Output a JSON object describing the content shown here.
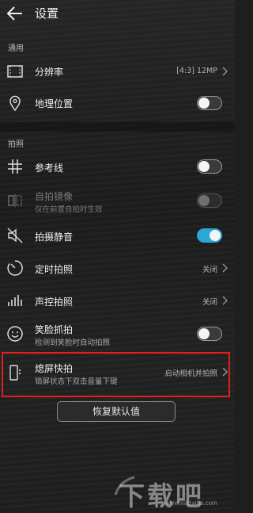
{
  "header": {
    "title": "设置"
  },
  "sections": {
    "general": "通用",
    "photo": "拍照"
  },
  "rows": {
    "resolution": {
      "label": "分辨率",
      "value": "[4:3] 12MP"
    },
    "location": {
      "label": "地理位置",
      "toggle": "off"
    },
    "grid": {
      "label": "参考线",
      "toggle": "off"
    },
    "mirror": {
      "label": "自拍镜像",
      "sub": "仅在前置自拍时生效",
      "toggle": "off",
      "disabled": true
    },
    "mute": {
      "label": "拍摄静音",
      "toggle": "on"
    },
    "timer": {
      "label": "定时拍照",
      "value": "关闭"
    },
    "voice": {
      "label": "声控拍照",
      "value": "关闭"
    },
    "smile": {
      "label": "笑脸抓拍",
      "sub": "检测到笑脸时自动拍照",
      "toggle": "off"
    },
    "snapshot": {
      "label": "熄屏快拍",
      "sub": "锁屏状态下双击音量下键",
      "value": "启动相机并拍照"
    }
  },
  "reset_button": "恢复默认值",
  "watermark": {
    "text": "下载吧",
    "url": "www.xiazaiba.com"
  },
  "colors": {
    "accent": "#2aa6d8",
    "highlight": "#e02020"
  }
}
